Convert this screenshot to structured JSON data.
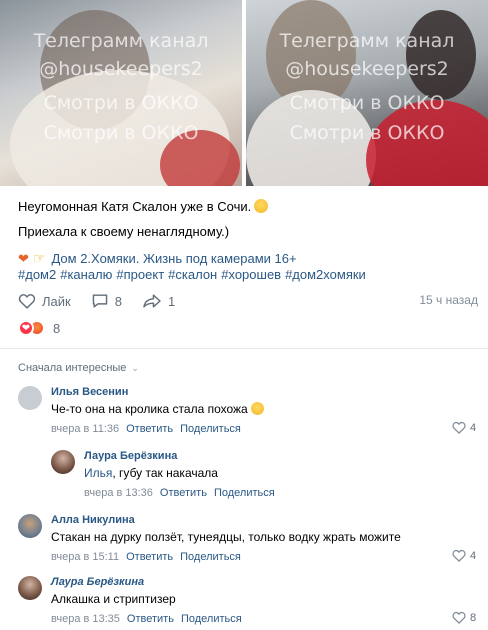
{
  "photos": {
    "watermark_line1": "Телеграмм канал",
    "watermark_line2": "@housekeepers2",
    "watermark_line3": "Смотри в ОККО",
    "watermark_line4": "Смотри в ОККО"
  },
  "post": {
    "text_line1": "Неугомонная Катя Скалон уже в Сочи.",
    "text_line2": "Приехала к своему ненаглядному.)",
    "link_text": "Дом 2.Хомяки. Жизнь под камерами 16+",
    "hashtags": [
      "#дом2",
      "#каналю",
      "#проект",
      "#скалон",
      "#хорошев",
      "#дом2хомяки"
    ],
    "like_label": "Лайк",
    "comments_count": "8",
    "shares_count": "1",
    "time": "15 ч назад",
    "reactions_count": "8"
  },
  "comments_section": {
    "sort_label": "Сначала интересные"
  },
  "comments": [
    {
      "author": "Илья Весенин",
      "text": "Че-то она на кролика стала похожа",
      "time": "вчера в 11:36",
      "reply_label": "Ответить",
      "share_label": "Поделиться",
      "likes": "4"
    },
    {
      "author": "Лаура Берёзкина",
      "mention": "Илья",
      "text": ", губу так накачала",
      "time": "вчера в 13:36",
      "reply_label": "Ответить",
      "share_label": "Поделиться"
    },
    {
      "author": "Алла Никулина",
      "text": "Стакан на дурку ползёт, тунеядцы, только водку жрать можите",
      "time": "вчера в 15:11",
      "reply_label": "Ответить",
      "share_label": "Поделиться",
      "likes": "4"
    },
    {
      "author": "Лаура Берёзкина",
      "text": "Алкашка и стриптизер",
      "time": "вчера в 13:35",
      "reply_label": "Ответить",
      "share_label": "Поделиться",
      "likes": "8"
    }
  ],
  "colors": {
    "link": "#2a5885",
    "meta": "#818c99",
    "reaction_heart": "#ff3347"
  }
}
